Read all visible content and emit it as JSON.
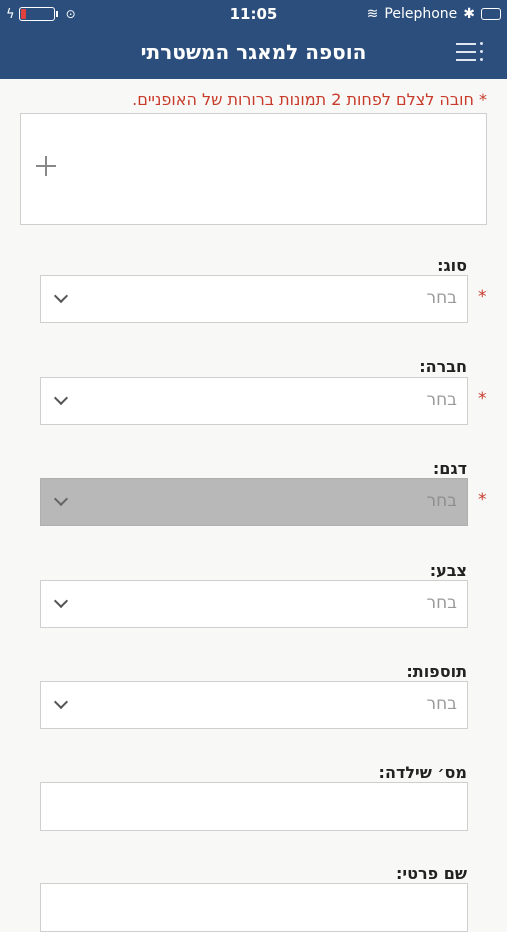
{
  "status_bar": {
    "time": "11:05",
    "carrier": "Pelephone",
    "battery_level": 0.15
  },
  "header": {
    "title": "הוספה למאגר המשטרתי",
    "menu_icon": "menu-icon"
  },
  "photo_notice": "* חובה לצלם לפחות 2 תמונות ברורות של האופניים.",
  "required_mark": "*",
  "fields": {
    "type": {
      "label": "סוג:",
      "value": "בחר",
      "required": true
    },
    "company": {
      "label": "חברה:",
      "value": "בחר",
      "required": true
    },
    "model": {
      "label": "דגם:",
      "value": "בחר",
      "required": true,
      "disabled": true
    },
    "color": {
      "label": "צבע:",
      "value": "בחר"
    },
    "extras": {
      "label": "תוספות:",
      "value": "בחר"
    },
    "frame_number": {
      "label": "מס׳ שילדה:",
      "value": ""
    },
    "first_name": {
      "label": "שם פרטי:",
      "value": ""
    }
  },
  "colors": {
    "header_bg": "#2c4e7c",
    "required": "#c83a2a",
    "disabled_bg": "#b8b8b8"
  }
}
